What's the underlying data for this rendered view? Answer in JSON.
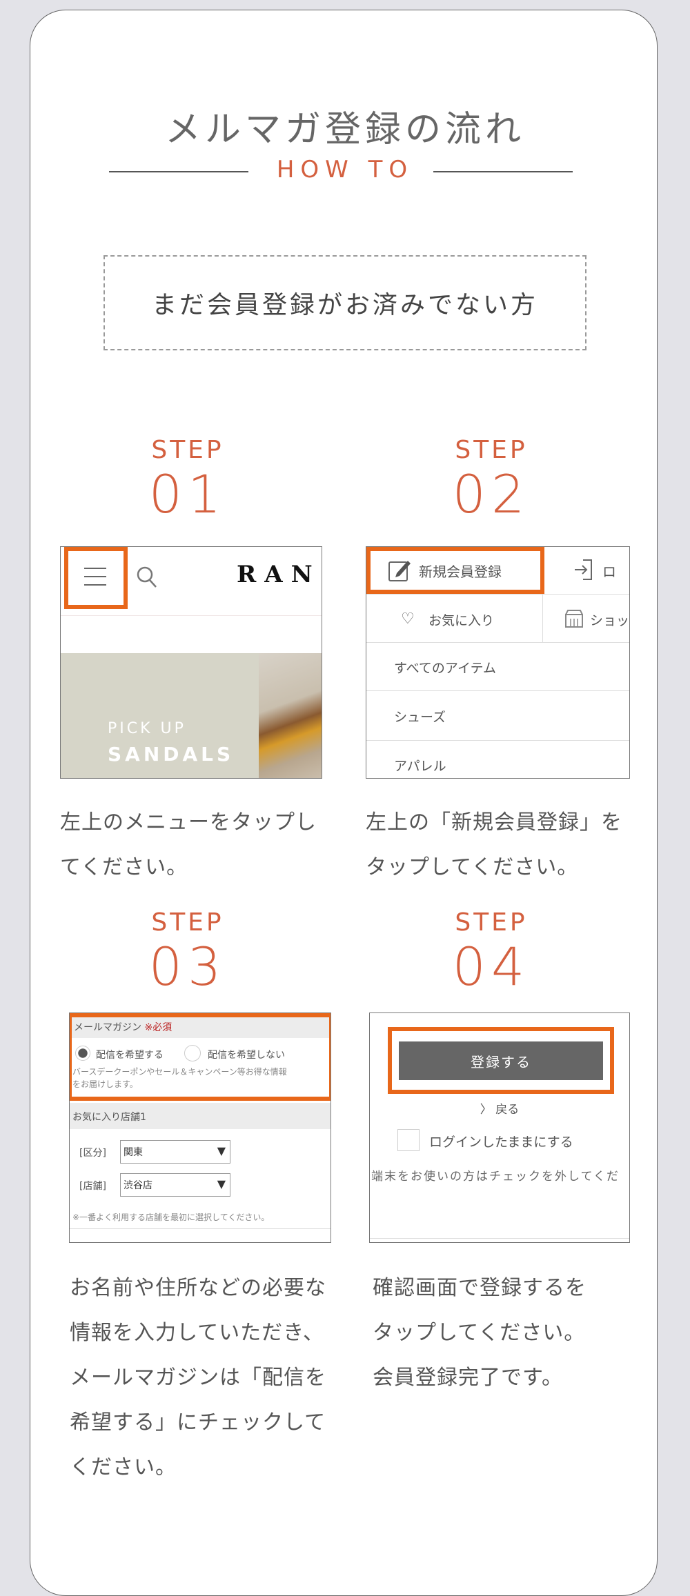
{
  "title": "メルマガ登録の流れ",
  "subtitle": "HOW TO",
  "section_label": "まだ会員登録がお済みでない方",
  "colors": {
    "accent": "#d4603f",
    "highlight": "#e8671a",
    "text": "#555555",
    "background": "#e3e3e8"
  },
  "steps": [
    {
      "label": "STEP",
      "number": "01",
      "text_lines": [
        "左上のメニューをタップし",
        "てください。"
      ],
      "screen": {
        "logo": "RAN",
        "banner_line1": "PICK UP",
        "banner_line2": "SANDALS",
        "icons": [
          "menu-icon",
          "search-icon"
        ]
      }
    },
    {
      "label": "STEP",
      "number": "02",
      "text_lines": [
        "左上の「新規会員登録」を",
        "タップしてください。"
      ],
      "screen": {
        "register": "新規会員登録",
        "login": "ロ",
        "favorites": "お気に入り",
        "shop": "ショッ",
        "menu_items": [
          "すべてのアイテム",
          "シューズ",
          "アパレル"
        ]
      }
    },
    {
      "label": "STEP",
      "number": "03",
      "text_lines": [
        "お名前や住所などの必要な",
        "情報を入力していただき、",
        "メールマガジンは「配信を",
        "希望する」にチェックして",
        "ください。"
      ],
      "screen": {
        "mailmag": "メールマガジン",
        "required": "※必須",
        "opt_in": "配信を希望する",
        "opt_out": "配信を希望しない",
        "opt_in_selected": true,
        "note1": "バースデークーポンやセール＆キャンペーン等お得な情報",
        "note2": "をお届けします。",
        "fav_store": "お気に入り店舗1",
        "area_label": "[区分]",
        "area_value": "関東",
        "store_label": "[店舗]",
        "store_value": "渋谷店",
        "store_note": "※一番よく利用する店舗を最初に選択してください。"
      }
    },
    {
      "label": "STEP",
      "number": "04",
      "text_lines": [
        "確認画面で登録するを",
        "タップしてください。",
        "会員登録完了です。"
      ],
      "screen": {
        "submit": "登録する",
        "back": "〉 戻る",
        "keep_login": "ログインしたままにする",
        "keep_login_checked": false,
        "note": "端末をお使いの方はチェックを外してくだ"
      }
    }
  ]
}
